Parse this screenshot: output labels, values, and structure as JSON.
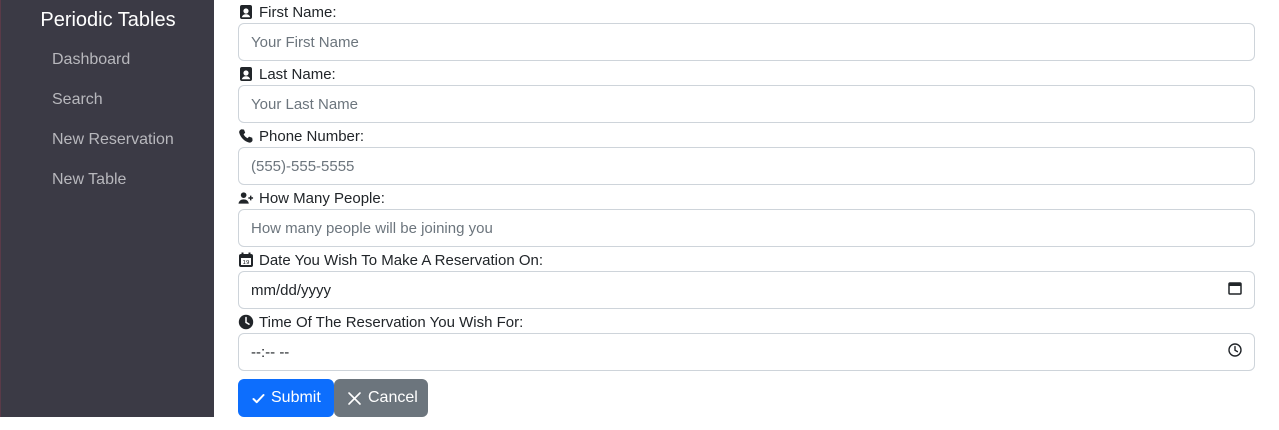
{
  "sidebar": {
    "brand": "Periodic Tables",
    "items": [
      {
        "label": "Dashboard"
      },
      {
        "label": "Search"
      },
      {
        "label": "New Reservation"
      },
      {
        "label": "New Table"
      }
    ]
  },
  "form": {
    "first_name": {
      "label": "First Name:",
      "placeholder": "Your First Name",
      "icon": "person-badge-icon"
    },
    "last_name": {
      "label": "Last Name:",
      "placeholder": "Your Last Name",
      "icon": "person-badge-icon"
    },
    "phone": {
      "label": "Phone Number:",
      "placeholder": "(555)-555-5555",
      "icon": "phone-icon"
    },
    "people": {
      "label": "How Many People:",
      "placeholder": "How many people will be joining you",
      "icon": "person-plus-icon"
    },
    "date": {
      "label": "Date You Wish To Make A Reservation On:",
      "value": "mm/dd/yyyy",
      "icon": "calendar-icon"
    },
    "time": {
      "label": "Time Of The Reservation You Wish For:",
      "value": "--:-- --",
      "icon": "clock-icon"
    }
  },
  "buttons": {
    "submit": "Submit",
    "cancel": "Cancel"
  },
  "colors": {
    "sidebar_bg": "#3b3a45",
    "primary": "#0d6efd",
    "secondary": "#6c757d"
  }
}
